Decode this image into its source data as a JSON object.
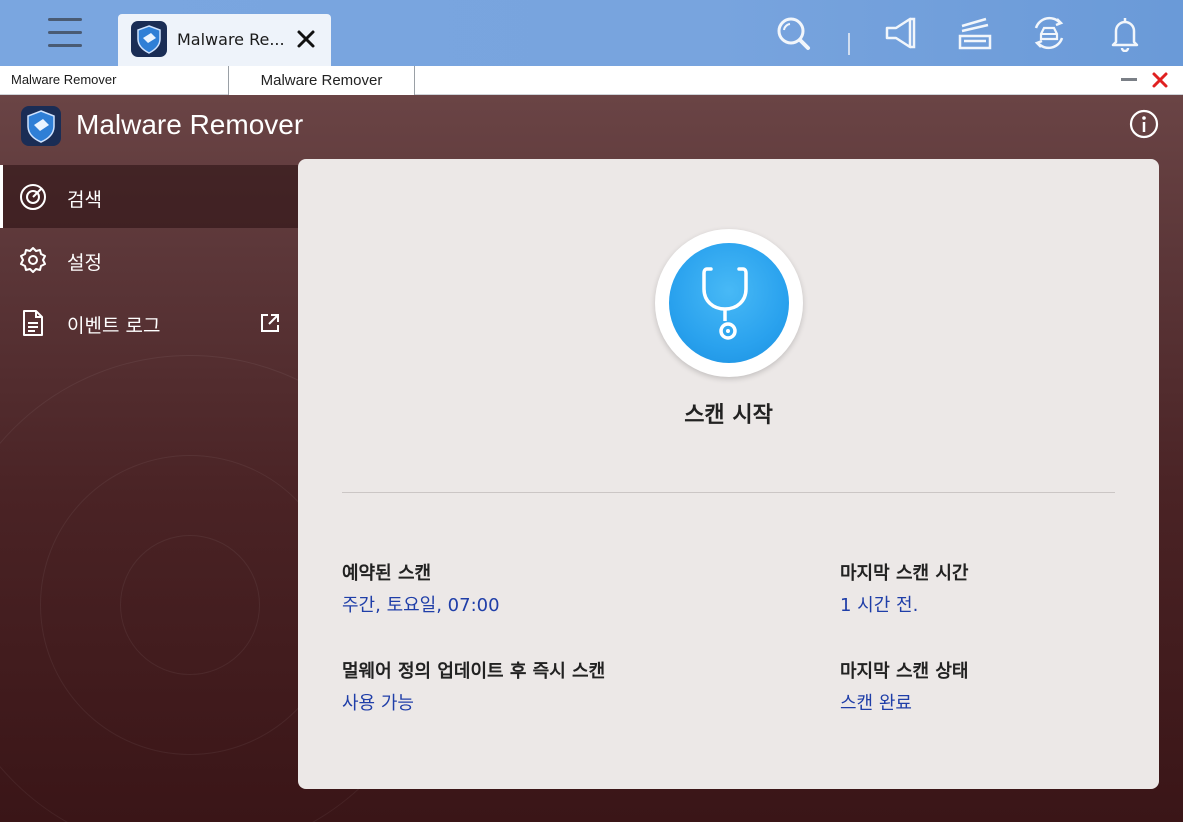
{
  "taskbar": {
    "tab_title": "Malware Re..."
  },
  "window": {
    "title": "Malware Remover",
    "tooltip": "Malware Remover"
  },
  "app": {
    "title": "Malware Remover"
  },
  "sidebar": {
    "items": [
      {
        "label": "검색",
        "icon": "radar-icon",
        "active": true
      },
      {
        "label": "설정",
        "icon": "gear-icon",
        "active": false
      },
      {
        "label": "이벤트 로그",
        "icon": "document-icon",
        "active": false
      }
    ]
  },
  "main": {
    "scan_label": "스캔 시작",
    "scheduled": {
      "label": "예약된 스캔",
      "value": "주간, 토요일, 07:00"
    },
    "last_time": {
      "label": "마지막 스캔 시간",
      "value": "1 시간 전."
    },
    "after_update": {
      "label": "멀웨어 정의 업데이트 후 즉시 스캔",
      "value": "사용 가능"
    },
    "last_status": {
      "label": "마지막 스캔 상태",
      "value": "스캔 완료"
    }
  },
  "colors": {
    "accent": "#2aa2ee",
    "link": "#1f3ea8",
    "close": "#e02020"
  }
}
